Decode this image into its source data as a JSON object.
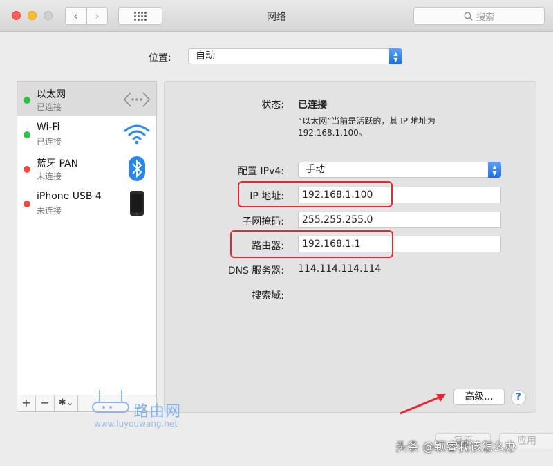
{
  "window": {
    "title": "网络",
    "search_placeholder": "搜索",
    "nav": {
      "back": "‹",
      "forward": "›"
    }
  },
  "location": {
    "label": "位置:",
    "value": "自动"
  },
  "services": [
    {
      "name": "以太网",
      "status": "已连接",
      "status_color": "#2bc43e",
      "icon": "ethernet-icon"
    },
    {
      "name": "Wi-Fi",
      "status": "已连接",
      "status_color": "#2bc43e",
      "icon": "wifi-icon"
    },
    {
      "name": "蓝牙 PAN",
      "status": "未连接",
      "status_color": "#f0483e",
      "icon": "bluetooth-icon"
    },
    {
      "name": "iPhone USB 4",
      "status": "未连接",
      "status_color": "#f0483e",
      "icon": "iphone-icon"
    }
  ],
  "sidebar_tools": {
    "add": "+",
    "remove": "−",
    "gear": "✱⌄"
  },
  "detail": {
    "status_label": "状态:",
    "status_value": "已连接",
    "status_desc_line1": "“以太网”当前是活跃的，其 IP 地址为",
    "status_desc_line2": "192.168.1.100。",
    "config_label": "配置 IPv4:",
    "config_value": "手动",
    "ip_label": "IP 地址:",
    "ip_value": "192.168.1.100",
    "subnet_label": "子网掩码:",
    "subnet_value": "255.255.255.0",
    "router_label": "路由器:",
    "router_value": "192.168.1.1",
    "dns_label": "DNS 服务器:",
    "dns_value": "114.114.114.114",
    "search_domain_label": "搜索域:"
  },
  "buttons": {
    "advanced": "高级...",
    "help": "?",
    "revert": "复原",
    "apply": "应用"
  },
  "watermark": {
    "brand": "路由网",
    "url": "www.luyouwang.net"
  },
  "caption": "头条 @颖睿我该怎么办",
  "colors": {
    "highlight": "#e8262f",
    "accent": "#1f6ee4"
  }
}
